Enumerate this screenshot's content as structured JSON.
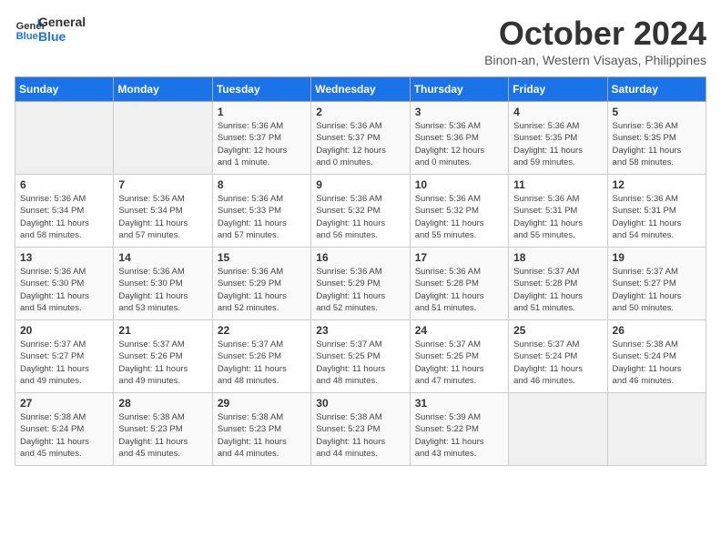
{
  "logo": {
    "line1": "General",
    "line2": "Blue"
  },
  "title": "October 2024",
  "subtitle": "Binon-an, Western Visayas, Philippines",
  "weekdays": [
    "Sunday",
    "Monday",
    "Tuesday",
    "Wednesday",
    "Thursday",
    "Friday",
    "Saturday"
  ],
  "weeks": [
    [
      {
        "day": "",
        "info": ""
      },
      {
        "day": "",
        "info": ""
      },
      {
        "day": "1",
        "info": "Sunrise: 5:36 AM\nSunset: 5:37 PM\nDaylight: 12 hours\nand 1 minute."
      },
      {
        "day": "2",
        "info": "Sunrise: 5:36 AM\nSunset: 5:37 PM\nDaylight: 12 hours\nand 0 minutes."
      },
      {
        "day": "3",
        "info": "Sunrise: 5:36 AM\nSunset: 5:36 PM\nDaylight: 12 hours\nand 0 minutes."
      },
      {
        "day": "4",
        "info": "Sunrise: 5:36 AM\nSunset: 5:35 PM\nDaylight: 11 hours\nand 59 minutes."
      },
      {
        "day": "5",
        "info": "Sunrise: 5:36 AM\nSunset: 5:35 PM\nDaylight: 11 hours\nand 58 minutes."
      }
    ],
    [
      {
        "day": "6",
        "info": "Sunrise: 5:36 AM\nSunset: 5:34 PM\nDaylight: 11 hours\nand 58 minutes."
      },
      {
        "day": "7",
        "info": "Sunrise: 5:36 AM\nSunset: 5:34 PM\nDaylight: 11 hours\nand 57 minutes."
      },
      {
        "day": "8",
        "info": "Sunrise: 5:36 AM\nSunset: 5:33 PM\nDaylight: 11 hours\nand 57 minutes."
      },
      {
        "day": "9",
        "info": "Sunrise: 5:36 AM\nSunset: 5:32 PM\nDaylight: 11 hours\nand 56 minutes."
      },
      {
        "day": "10",
        "info": "Sunrise: 5:36 AM\nSunset: 5:32 PM\nDaylight: 11 hours\nand 55 minutes."
      },
      {
        "day": "11",
        "info": "Sunrise: 5:36 AM\nSunset: 5:31 PM\nDaylight: 11 hours\nand 55 minutes."
      },
      {
        "day": "12",
        "info": "Sunrise: 5:36 AM\nSunset: 5:31 PM\nDaylight: 11 hours\nand 54 minutes."
      }
    ],
    [
      {
        "day": "13",
        "info": "Sunrise: 5:36 AM\nSunset: 5:30 PM\nDaylight: 11 hours\nand 54 minutes."
      },
      {
        "day": "14",
        "info": "Sunrise: 5:36 AM\nSunset: 5:30 PM\nDaylight: 11 hours\nand 53 minutes."
      },
      {
        "day": "15",
        "info": "Sunrise: 5:36 AM\nSunset: 5:29 PM\nDaylight: 11 hours\nand 52 minutes."
      },
      {
        "day": "16",
        "info": "Sunrise: 5:36 AM\nSunset: 5:29 PM\nDaylight: 11 hours\nand 52 minutes."
      },
      {
        "day": "17",
        "info": "Sunrise: 5:36 AM\nSunset: 5:28 PM\nDaylight: 11 hours\nand 51 minutes."
      },
      {
        "day": "18",
        "info": "Sunrise: 5:37 AM\nSunset: 5:28 PM\nDaylight: 11 hours\nand 51 minutes."
      },
      {
        "day": "19",
        "info": "Sunrise: 5:37 AM\nSunset: 5:27 PM\nDaylight: 11 hours\nand 50 minutes."
      }
    ],
    [
      {
        "day": "20",
        "info": "Sunrise: 5:37 AM\nSunset: 5:27 PM\nDaylight: 11 hours\nand 49 minutes."
      },
      {
        "day": "21",
        "info": "Sunrise: 5:37 AM\nSunset: 5:26 PM\nDaylight: 11 hours\nand 49 minutes."
      },
      {
        "day": "22",
        "info": "Sunrise: 5:37 AM\nSunset: 5:26 PM\nDaylight: 11 hours\nand 48 minutes."
      },
      {
        "day": "23",
        "info": "Sunrise: 5:37 AM\nSunset: 5:25 PM\nDaylight: 11 hours\nand 48 minutes."
      },
      {
        "day": "24",
        "info": "Sunrise: 5:37 AM\nSunset: 5:25 PM\nDaylight: 11 hours\nand 47 minutes."
      },
      {
        "day": "25",
        "info": "Sunrise: 5:37 AM\nSunset: 5:24 PM\nDaylight: 11 hours\nand 46 minutes."
      },
      {
        "day": "26",
        "info": "Sunrise: 5:38 AM\nSunset: 5:24 PM\nDaylight: 11 hours\nand 46 minutes."
      }
    ],
    [
      {
        "day": "27",
        "info": "Sunrise: 5:38 AM\nSunset: 5:24 PM\nDaylight: 11 hours\nand 45 minutes."
      },
      {
        "day": "28",
        "info": "Sunrise: 5:38 AM\nSunset: 5:23 PM\nDaylight: 11 hours\nand 45 minutes."
      },
      {
        "day": "29",
        "info": "Sunrise: 5:38 AM\nSunset: 5:23 PM\nDaylight: 11 hours\nand 44 minutes."
      },
      {
        "day": "30",
        "info": "Sunrise: 5:38 AM\nSunset: 5:23 PM\nDaylight: 11 hours\nand 44 minutes."
      },
      {
        "day": "31",
        "info": "Sunrise: 5:39 AM\nSunset: 5:22 PM\nDaylight: 11 hours\nand 43 minutes."
      },
      {
        "day": "",
        "info": ""
      },
      {
        "day": "",
        "info": ""
      }
    ]
  ]
}
